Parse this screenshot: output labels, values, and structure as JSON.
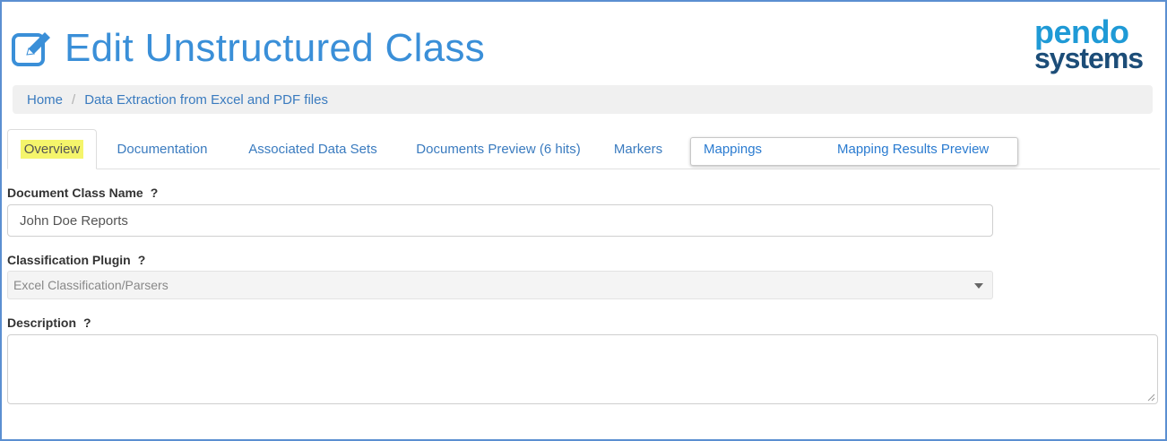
{
  "header": {
    "title": "Edit Unstructured Class",
    "title_icon": "edit-icon",
    "logo_line1": "pendo",
    "logo_line2": "systems"
  },
  "breadcrumb": {
    "items": [
      "Home",
      "Data Extraction from Excel and PDF files"
    ]
  },
  "tabs": [
    {
      "label": "Overview",
      "active": true
    },
    {
      "label": "Documentation"
    },
    {
      "label": "Associated Data Sets"
    },
    {
      "label": "Documents Preview (6 hits)"
    },
    {
      "label": "Markers"
    },
    {
      "label": "Mappings"
    },
    {
      "label": "Mapping Results Preview"
    }
  ],
  "form": {
    "name_label": "Document Class Name",
    "name_value": "John Doe Reports",
    "plugin_label": "Classification Plugin",
    "plugin_value": "Excel Classification/Parsers",
    "description_label": "Description",
    "description_value": "",
    "help": "?"
  },
  "colors": {
    "accent": "#3a8fd8",
    "link": "#3a7bbf",
    "highlight": "#f5f56b",
    "border": "#5b8fd1"
  }
}
